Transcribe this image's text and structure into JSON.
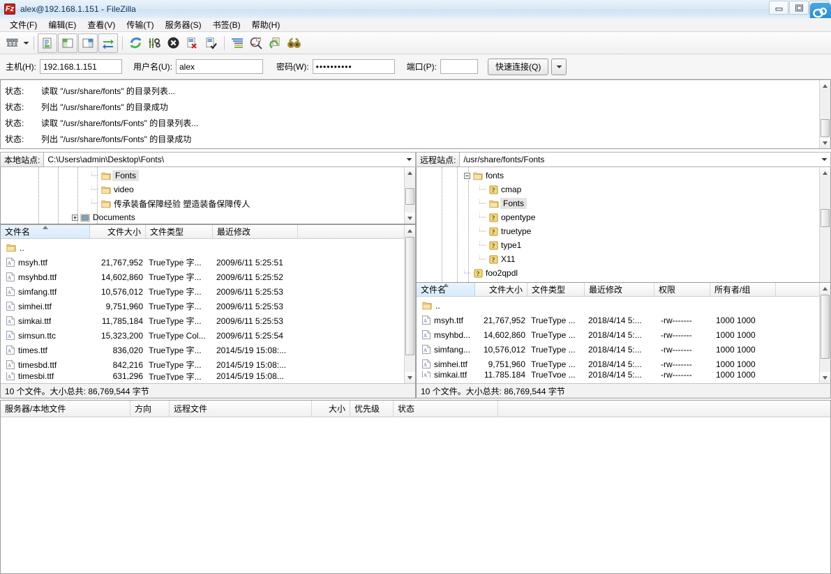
{
  "window": {
    "title": "alex@192.168.1.151 - FileZilla",
    "app_icon": "filezilla-icon",
    "minimize": "minimize-button",
    "maximize": "maximize-button",
    "close": "close-button"
  },
  "menu": {
    "items": [
      {
        "label": "文件(F)",
        "name": "menu-file"
      },
      {
        "label": "编辑(E)",
        "name": "menu-edit"
      },
      {
        "label": "查看(V)",
        "name": "menu-view"
      },
      {
        "label": "传输(T)",
        "name": "menu-transfer"
      },
      {
        "label": "服务器(S)",
        "name": "menu-server"
      },
      {
        "label": "书签(B)",
        "name": "menu-bookmarks"
      },
      {
        "label": "帮助(H)",
        "name": "menu-help"
      }
    ]
  },
  "toolbar": {
    "buttons": [
      "site-manager-icon",
      "site-manager-dropdown-icon",
      "toggle-message-log-icon",
      "toggle-local-tree-icon",
      "toggle-remote-tree-icon",
      "toggle-transfer-queue-icon",
      "refresh-icon",
      "process-queue-icon",
      "cancel-icon",
      "disconnect-icon",
      "reconnect-icon",
      "filter-icon",
      "compare-directories-icon",
      "synchronized-browsing-icon",
      "find-files-icon"
    ]
  },
  "quickconnect": {
    "host_label": "主机(H):",
    "host_value": "192.168.1.151",
    "user_label": "用户名(U):",
    "user_value": "alex",
    "password_label": "密码(W):",
    "password_value": "••••••••••",
    "port_label": "端口(P):",
    "port_value": "",
    "connect_label": "快速连接(Q)",
    "dropdown_icon": "chevron-down-icon"
  },
  "log": {
    "rows": [
      {
        "key": "状态:",
        "message": "读取 \"/usr/share/fonts\" 的目录列表..."
      },
      {
        "key": "状态:",
        "message": "列出 \"/usr/share/fonts\" 的目录成功"
      },
      {
        "key": "状态:",
        "message": "读取 \"/usr/share/fonts/Fonts\" 的目录列表..."
      },
      {
        "key": "状态:",
        "message": "列出 \"/usr/share/fonts/Fonts\" 的目录成功"
      }
    ]
  },
  "local": {
    "site_label": "本地站点:",
    "site_path": "C:\\Users\\admin\\Desktop\\Fonts\\",
    "dropdown_icon": "chevron-down-icon",
    "tree": [
      {
        "label": "Fonts",
        "icon": "folder-icon",
        "selected": true,
        "indent": 5,
        "expander": ""
      },
      {
        "label": "video",
        "icon": "folder-icon",
        "selected": false,
        "indent": 5,
        "expander": ""
      },
      {
        "label": "传承装备保障经验 塑造装备保障传人",
        "icon": "folder-icon",
        "selected": false,
        "indent": 5,
        "expander": ""
      },
      {
        "label": "Documents",
        "icon": "special-folder-icon",
        "selected": false,
        "indent": 4,
        "expander": "+"
      }
    ],
    "columns": [
      {
        "label": "文件名",
        "align": "left",
        "sorted": true
      },
      {
        "label": "文件大小",
        "align": "right",
        "sorted": false
      },
      {
        "label": "文件类型",
        "align": "left",
        "sorted": false
      },
      {
        "label": "最近修改",
        "align": "left",
        "sorted": false
      },
      {
        "label": "",
        "align": "left",
        "sorted": false
      }
    ],
    "rows": [
      {
        "icon": "folder-icon",
        "name": "..",
        "size": "",
        "type": "",
        "modified": ""
      },
      {
        "icon": "font-file-icon",
        "name": "msyh.ttf",
        "size": "21,767,952",
        "type": "TrueType 字...",
        "modified": "2009/6/11 5:25:51"
      },
      {
        "icon": "font-file-icon",
        "name": "msyhbd.ttf",
        "size": "14,602,860",
        "type": "TrueType 字...",
        "modified": "2009/6/11 5:25:52"
      },
      {
        "icon": "font-file-icon",
        "name": "simfang.ttf",
        "size": "10,576,012",
        "type": "TrueType 字...",
        "modified": "2009/6/11 5:25:53"
      },
      {
        "icon": "font-file-icon",
        "name": "simhei.ttf",
        "size": "9,751,960",
        "type": "TrueType 字...",
        "modified": "2009/6/11 5:25:53"
      },
      {
        "icon": "font-file-icon",
        "name": "simkai.ttf",
        "size": "11,785,184",
        "type": "TrueType 字...",
        "modified": "2009/6/11 5:25:53"
      },
      {
        "icon": "font-file-icon",
        "name": "simsun.ttc",
        "size": "15,323,200",
        "type": "TrueType Col...",
        "modified": "2009/6/11 5:25:54"
      },
      {
        "icon": "font-file-icon",
        "name": "times.ttf",
        "size": "836,020",
        "type": "TrueType 字...",
        "modified": "2014/5/19 15:08:..."
      },
      {
        "icon": "font-file-icon",
        "name": "timesbd.ttf",
        "size": "842,216",
        "type": "TrueType 字...",
        "modified": "2014/5/19 15:08:..."
      },
      {
        "icon": "font-file-icon",
        "name": "timesbi.ttf",
        "size": "631,296",
        "type": "TrueType 字...",
        "modified": "2014/5/19 15:08..."
      }
    ],
    "status": "10 个文件。大小总共: 86,769,544 字节"
  },
  "remote": {
    "site_label": "远程站点:",
    "site_path": "/usr/share/fonts/Fonts",
    "dropdown_icon": "chevron-down-icon",
    "tree": [
      {
        "label": "fonts",
        "icon": "folder-icon",
        "selected": false,
        "indent": 3,
        "expander": "-"
      },
      {
        "label": "cmap",
        "icon": "unknown-icon",
        "selected": false,
        "indent": 4,
        "expander": ""
      },
      {
        "label": "Fonts",
        "icon": "folder-icon",
        "selected": true,
        "indent": 4,
        "expander": ""
      },
      {
        "label": "opentype",
        "icon": "unknown-icon",
        "selected": false,
        "indent": 4,
        "expander": ""
      },
      {
        "label": "truetype",
        "icon": "unknown-icon",
        "selected": false,
        "indent": 4,
        "expander": ""
      },
      {
        "label": "type1",
        "icon": "unknown-icon",
        "selected": false,
        "indent": 4,
        "expander": ""
      },
      {
        "label": "X11",
        "icon": "unknown-icon",
        "selected": false,
        "indent": 4,
        "expander": ""
      },
      {
        "label": "foo2qpdl",
        "icon": "unknown-icon",
        "selected": false,
        "indent": 3,
        "expander": ""
      }
    ],
    "columns": [
      {
        "label": "文件名",
        "align": "left",
        "sorted": true
      },
      {
        "label": "文件大小",
        "align": "right",
        "sorted": false
      },
      {
        "label": "文件类型",
        "align": "left",
        "sorted": false
      },
      {
        "label": "最近修改",
        "align": "left",
        "sorted": false
      },
      {
        "label": "权限",
        "align": "left",
        "sorted": false
      },
      {
        "label": "所有者/组",
        "align": "left",
        "sorted": false
      },
      {
        "label": "",
        "align": "left",
        "sorted": false
      }
    ],
    "rows": [
      {
        "icon": "folder-icon",
        "name": "..",
        "size": "",
        "type": "",
        "modified": "",
        "perms": "",
        "owner": ""
      },
      {
        "icon": "font-file-icon",
        "name": "msyh.ttf",
        "size": "21,767,952",
        "type": "TrueType ...",
        "modified": "2018/4/14 5:...",
        "perms": "-rw-------",
        "owner": "1000 1000"
      },
      {
        "icon": "font-file-icon",
        "name": "msyhbd...",
        "size": "14,602,860",
        "type": "TrueType ...",
        "modified": "2018/4/14 5:...",
        "perms": "-rw-------",
        "owner": "1000 1000"
      },
      {
        "icon": "font-file-icon",
        "name": "simfang...",
        "size": "10,576,012",
        "type": "TrueType ...",
        "modified": "2018/4/14 5:...",
        "perms": "-rw-------",
        "owner": "1000 1000"
      },
      {
        "icon": "font-file-icon",
        "name": "simhei.ttf",
        "size": "9,751,960",
        "type": "TrueType ...",
        "modified": "2018/4/14 5:...",
        "perms": "-rw-------",
        "owner": "1000 1000"
      },
      {
        "icon": "font-file-icon",
        "name": "simkai.ttf",
        "size": "11,785,184",
        "type": "TrueType ...",
        "modified": "2018/4/14 5:...",
        "perms": "-rw-------",
        "owner": "1000 1000"
      }
    ],
    "status": "10 个文件。大小总共: 86,769,544 字节"
  },
  "queue": {
    "columns": [
      {
        "label": "服务器/本地文件",
        "align": "left"
      },
      {
        "label": "方向",
        "align": "left"
      },
      {
        "label": "远程文件",
        "align": "left"
      },
      {
        "label": "大小",
        "align": "right"
      },
      {
        "label": "优先级",
        "align": "left"
      },
      {
        "label": "状态",
        "align": "left"
      },
      {
        "label": "",
        "align": "left"
      }
    ],
    "rows": []
  },
  "colors": {
    "title_accent": "#10305a",
    "header_select": "#d6ebfb",
    "folder": "#f2ce78",
    "selection": "#e4e4e4"
  }
}
